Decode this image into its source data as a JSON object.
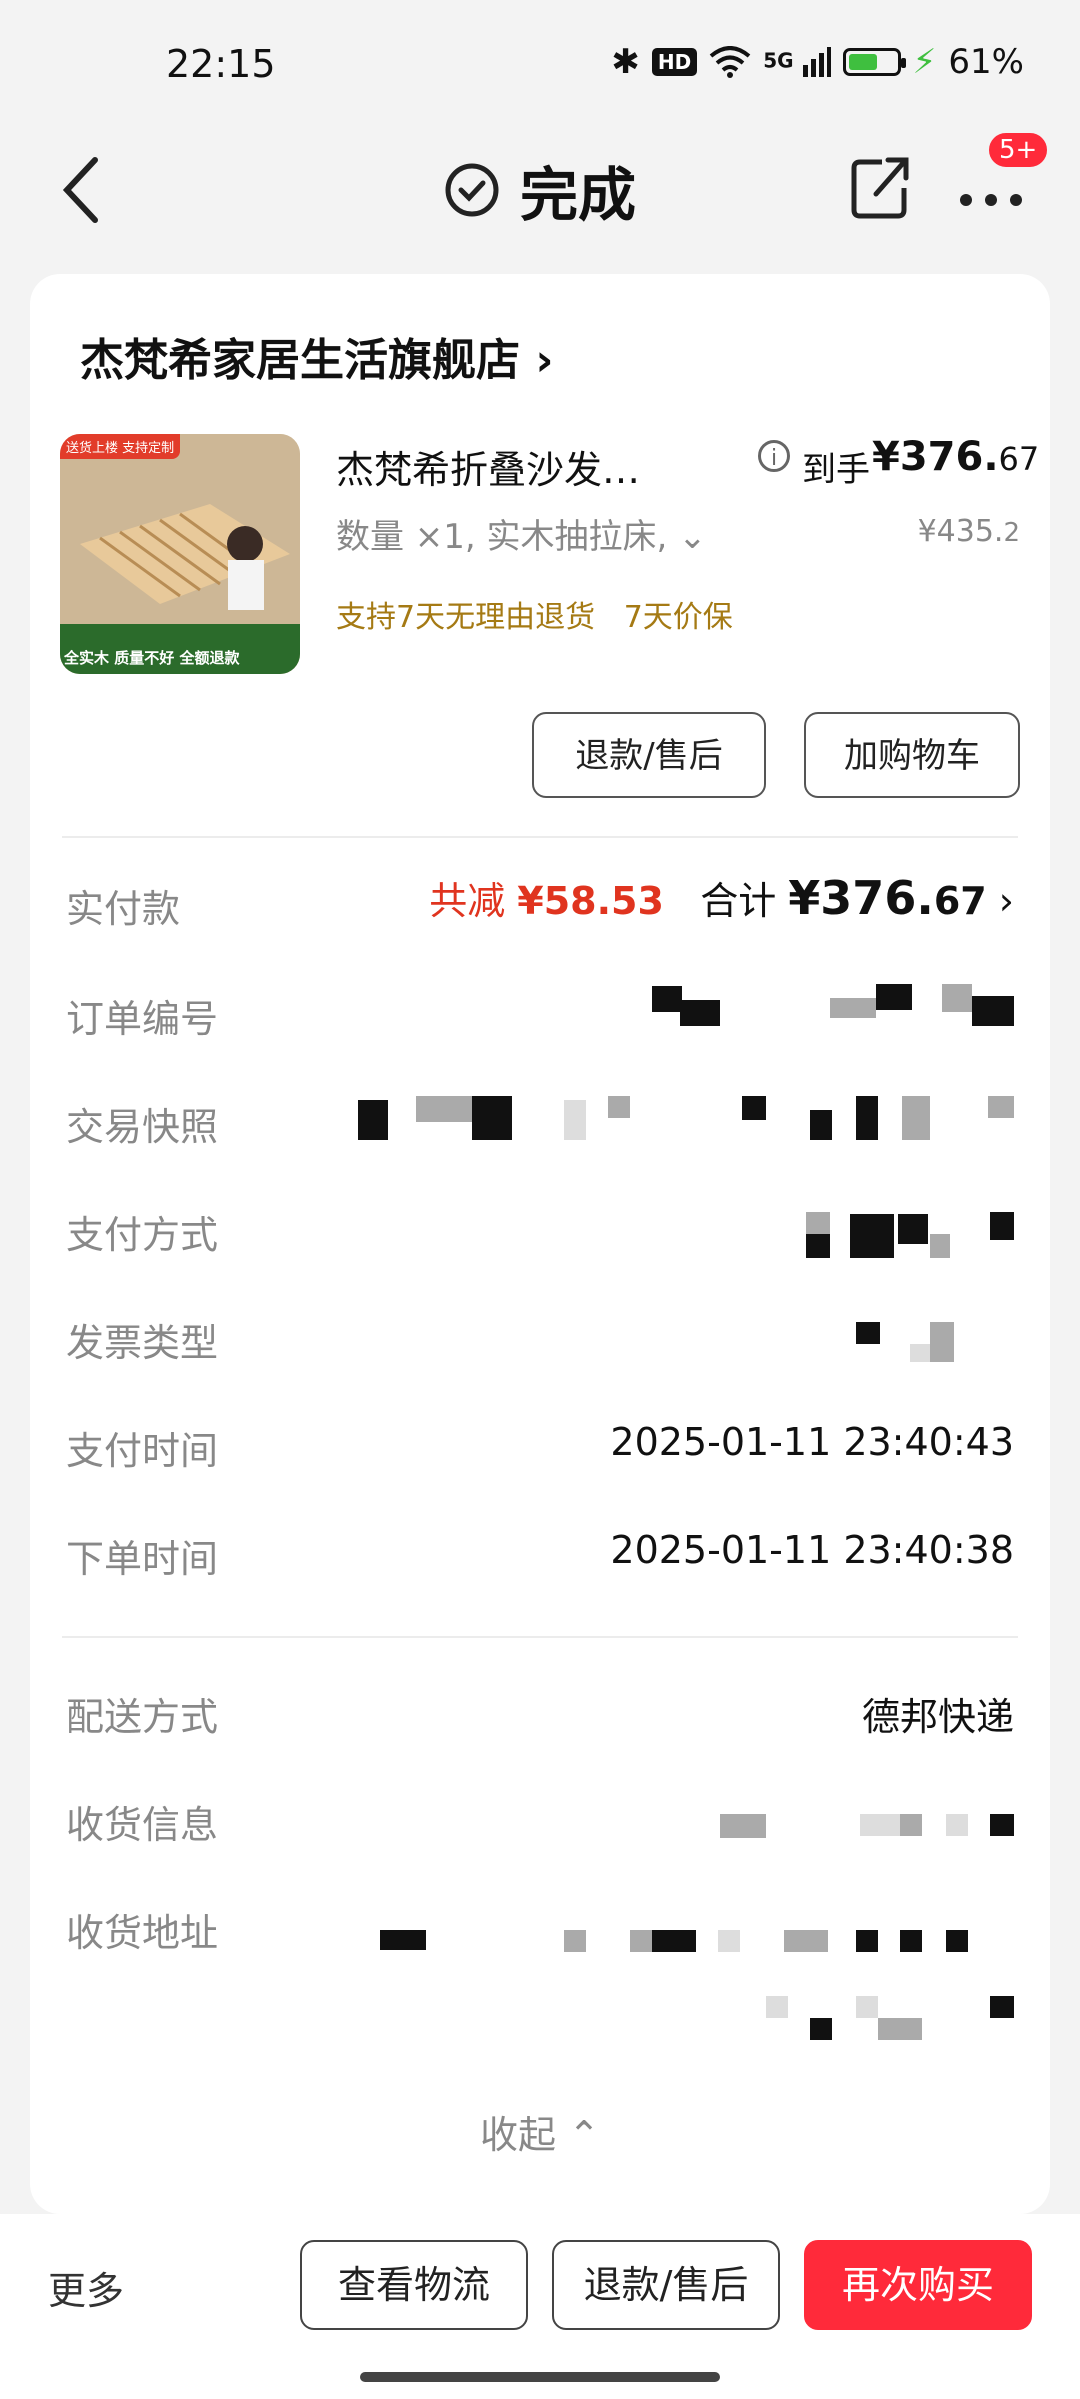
{
  "status_bar": {
    "time": "22:15",
    "hd": "HD",
    "signal": "5G",
    "battery_percent_text": "61%",
    "battery_level": 0.61
  },
  "nav": {
    "title": "完成",
    "badge": "5+"
  },
  "store": {
    "name": "杰梵希家居生活旗舰店",
    "chevron": "›"
  },
  "product": {
    "image_banner": "送货上楼 支持定制",
    "image_bottom": "全实木  质量不好  全额退款",
    "name": "杰梵希折叠沙发…",
    "price_label": "到手",
    "price_int": "¥376.",
    "price_dec": "67",
    "spec": "数量 ×1, 实木抽拉床, ⌄",
    "original_int": "¥435.",
    "original_dec": "2",
    "guarantee": "支持7天无理由退货   7天价保",
    "btn_refund": "退款/售后",
    "btn_cart": "加购物车"
  },
  "payment": {
    "label": "实付款",
    "discount_label": "共减",
    "discount_amount": "¥58.53",
    "total_label": "合计",
    "total_int": "¥376.",
    "total_dec": "67",
    "chevron": "›"
  },
  "details": [
    {
      "label": "订单编号",
      "value": ""
    },
    {
      "label": "交易快照",
      "value": ""
    },
    {
      "label": "支付方式",
      "value": ""
    },
    {
      "label": "发票类型",
      "value": ""
    },
    {
      "label": "支付时间",
      "value": "2025-01-11 23:40:43"
    },
    {
      "label": "下单时间",
      "value": "2025-01-11 23:40:38"
    }
  ],
  "shipping": [
    {
      "label": "配送方式",
      "value": "德邦快递"
    },
    {
      "label": "收货信息",
      "value": ""
    },
    {
      "label": "收货地址",
      "value": ""
    }
  ],
  "collapse_label": "收起 ⌃",
  "bottom_bar": {
    "more": "更多",
    "logistics": "查看物流",
    "refund": "退款/售后",
    "rebuy": "再次购买"
  },
  "colors": {
    "accent_red": "#ff2a3a",
    "discount_red": "#e0341f",
    "guarantee_gold": "#a57a14"
  }
}
